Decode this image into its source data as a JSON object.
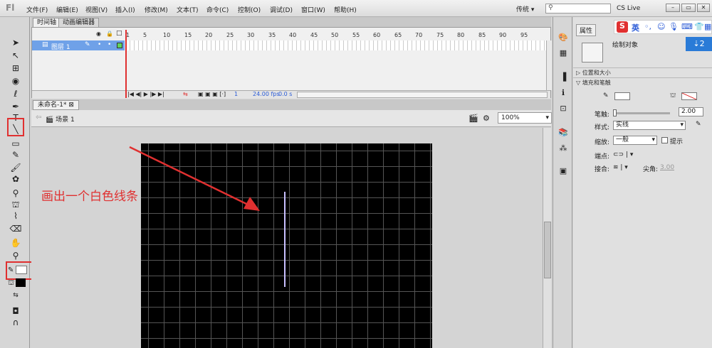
{
  "app": {
    "logo": "Fl"
  },
  "menu": [
    {
      "label": "文件(F)"
    },
    {
      "label": "编辑(E)"
    },
    {
      "label": "视图(V)"
    },
    {
      "label": "插入(I)"
    },
    {
      "label": "修改(M)"
    },
    {
      "label": "文本(T)"
    },
    {
      "label": "命令(C)"
    },
    {
      "label": "控制(O)"
    },
    {
      "label": "调试(D)"
    },
    {
      "label": "窗口(W)"
    },
    {
      "label": "帮助(H)"
    }
  ],
  "topbar": {
    "workspace": "传统 ▾",
    "search_placeholder": "",
    "cs_live": "CS Live"
  },
  "timeline": {
    "tabs": [
      "时间轴",
      "动画编辑器"
    ],
    "frame_numbers": [
      "1",
      "5",
      "10",
      "15",
      "20",
      "25",
      "30",
      "35",
      "40",
      "45",
      "50",
      "55",
      "60",
      "65",
      "70",
      "75",
      "80",
      "85",
      "90",
      "95"
    ],
    "layer_name": "图层 1",
    "status": {
      "frame": "1",
      "fps": "24.00 fps",
      "time": "0.0 s"
    }
  },
  "document": {
    "tab": "未命名-1*",
    "scene": "场景 1",
    "zoom": "100%"
  },
  "annotation": "画出一个白色线条",
  "properties": {
    "tab": "属性",
    "object_type": "绘制对象",
    "sections": {
      "position_size": "位置和大小",
      "fill_stroke": "填充和笔触"
    },
    "stroke_label": "笔触:",
    "stroke_value": "2.00",
    "style_label": "样式:",
    "style_value": "实线",
    "scale_label": "缩放:",
    "scale_value": "一般",
    "hint_label": "提示",
    "cap_label": "端点:",
    "join_label": "接合:",
    "miter_label": "尖角:",
    "miter_value": "3.00"
  },
  "sogou": {
    "logo": "S",
    "lang": "英"
  },
  "colors": {
    "highlight": "#e03030",
    "layer_selected": "#6fa1e8",
    "stage": "#000000",
    "line": "#c8c0ff"
  }
}
